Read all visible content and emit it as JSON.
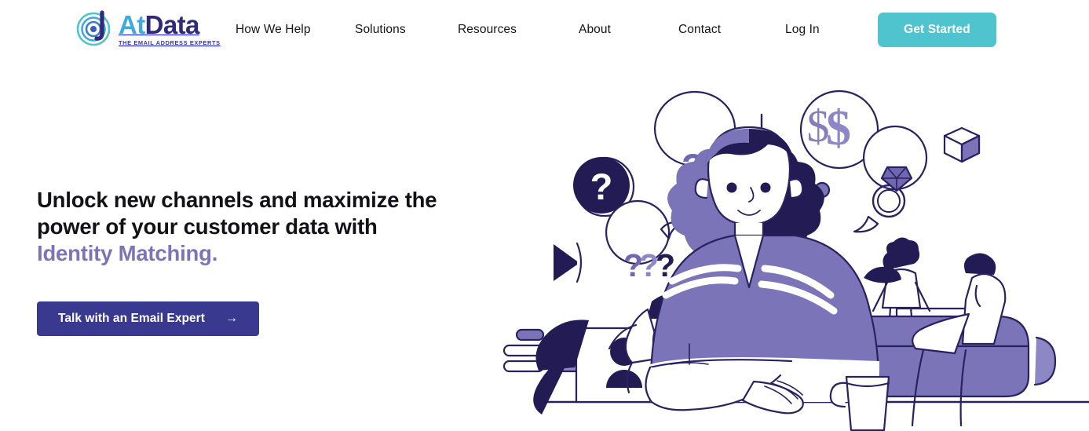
{
  "brand": {
    "logo_icon": "at-spiral-icon",
    "name_part1": "At",
    "name_part2": "Data",
    "tagline": "THE EMAIL ADDRESS EXPERTS",
    "color_at": "#3FA9E0",
    "color_data": "#2F2A7A"
  },
  "nav": {
    "items": [
      {
        "label": "How We Help"
      },
      {
        "label": "Solutions"
      },
      {
        "label": "Resources"
      },
      {
        "label": "About"
      },
      {
        "label": "Contact"
      },
      {
        "label": "Log In"
      }
    ],
    "cta": {
      "label": "Get Started",
      "color": "#4FC3CE"
    }
  },
  "hero": {
    "headline_line1": "Unlock new channels and maximize the",
    "headline_line2": "power of your customer data with",
    "headline_accent": "Identity Matching.",
    "accent_color": "#7B74B8",
    "cta": {
      "label": "Talk with an Email Expert",
      "arrow": "→",
      "color": "#393A8F"
    }
  },
  "illustration": {
    "name": "identity-matching-illustration",
    "palette": {
      "navy": "#221B54",
      "purple": "#7B74B8",
      "light_purple": "#8E87C6",
      "white": "#ffffff"
    },
    "elements": [
      {
        "name": "question-mark-circle",
        "label": "?"
      },
      {
        "name": "question-bubble-double",
        "label": "??"
      },
      {
        "name": "question-bubble-triple",
        "label": "???"
      },
      {
        "name": "dollar-thought-bubble",
        "label": "$$"
      },
      {
        "name": "diamond-ring-bubble",
        "label": "ring"
      },
      {
        "name": "cube-icon",
        "label": "cube"
      },
      {
        "name": "play-triangle-icon",
        "label": "triangle"
      },
      {
        "name": "person-folder-icon",
        "label": "folder"
      },
      {
        "name": "data-pills",
        "label": "bars"
      },
      {
        "name": "map-window-icon",
        "label": "map"
      },
      {
        "name": "central-woman-figure",
        "label": "woman"
      },
      {
        "name": "coffee-mug-icon",
        "label": "mug"
      },
      {
        "name": "sofa-people-group",
        "label": "sofa"
      },
      {
        "name": "vertical-divider-line",
        "label": "divider"
      },
      {
        "name": "desk-line",
        "label": "desk"
      }
    ]
  }
}
